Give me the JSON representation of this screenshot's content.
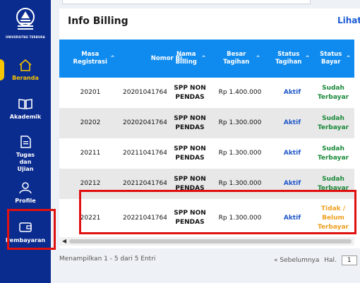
{
  "sidebar": {
    "logo_text": "UNIVERSITAS TERBUKA",
    "items": [
      {
        "label": "Beranda",
        "icon": "home-icon",
        "active": true
      },
      {
        "label": "Akademik",
        "icon": "book-icon"
      },
      {
        "label": "Tugas dan Ujian",
        "icon": "document-icon"
      },
      {
        "label": "Profile",
        "icon": "user-icon"
      },
      {
        "label": "Pembayaran",
        "icon": "wallet-icon"
      }
    ]
  },
  "card": {
    "title": "Info Billing",
    "link": "Lihat D"
  },
  "table": {
    "headers": [
      "Masa Registrasi",
      "Nomor Bi",
      "Nama Billing",
      "Besar Tagihan",
      "Status Tagihan",
      "Status Bayar"
    ],
    "rows": [
      {
        "masa": "20201",
        "nomor": "20201041764",
        "nama": "SPP NON PENDAS",
        "besar": "Rp 1.400.000",
        "status": "Aktif",
        "bayar": "Sudah Terbayar"
      },
      {
        "masa": "20202",
        "nomor": "20202041764",
        "nama": "SPP NON PENDAS",
        "besar": "Rp 1.300.000",
        "status": "Aktif",
        "bayar": "Sudah Terbayar"
      },
      {
        "masa": "20211",
        "nomor": "20211041764",
        "nama": "SPP NON PENDAS",
        "besar": "Rp 1.300.000",
        "status": "Aktif",
        "bayar": "Sudah Terbayar"
      },
      {
        "masa": "20212",
        "nomor": "20212041764",
        "nama": "SPP NON PENDAS",
        "besar": "Rp 1.300.000",
        "status": "Aktif",
        "bayar": "Sudah Terbayar"
      },
      {
        "masa": "20221",
        "nomor": "20221041764",
        "nama": "SPP NON PENDAS",
        "besar": "Rp 1.300.000",
        "status": "Aktif",
        "bayar": "Tidak / Belum Terbayar"
      }
    ]
  },
  "footer": {
    "summary": "Menampilkan 1 - 5 dari 5 Entri",
    "prev": "« Sebelumnya",
    "page_label": "Hal.",
    "page": "1"
  },
  "colors": {
    "sidebar": "#0b2c8f",
    "header": "#0f8bf0",
    "active": "#f6c400",
    "paid": "#1a8a3a",
    "unpaid": "#f0a020",
    "highlight": "#e01010"
  }
}
